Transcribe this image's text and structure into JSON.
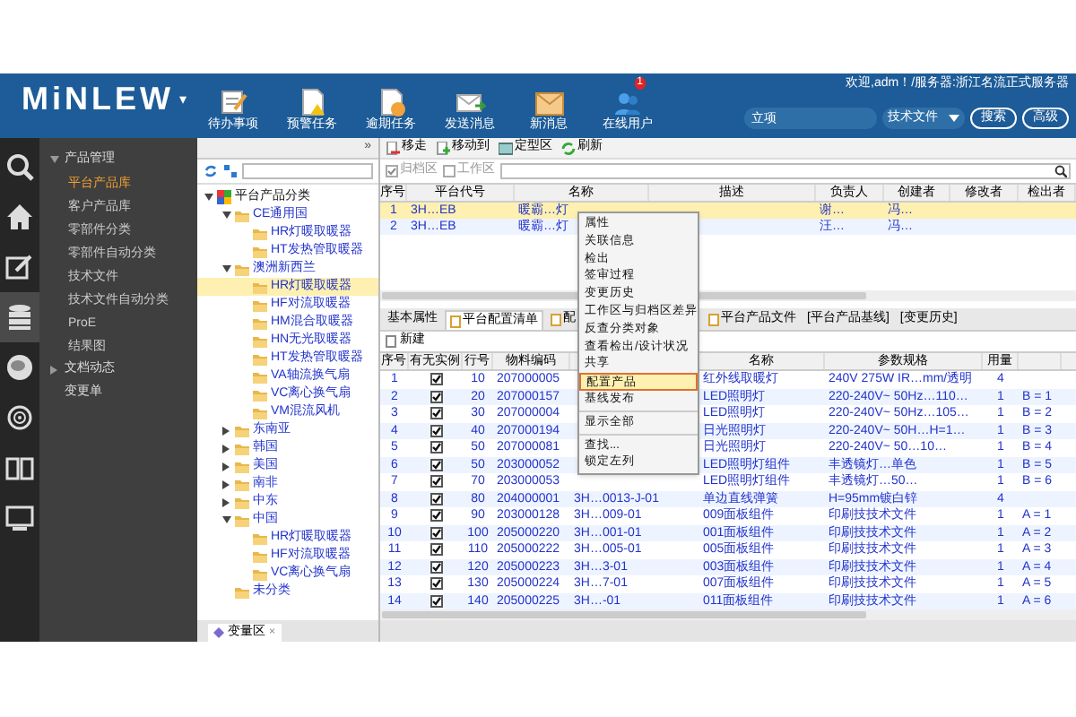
{
  "header": {
    "logo": "MiNLEW",
    "logo_caret": "▾",
    "welcome": "欢迎,adm！/服务器:浙江名流正式服务器",
    "nav_buttons": [
      {
        "label": "待办事项",
        "kind": "todo"
      },
      {
        "label": "预警任务",
        "kind": "warning"
      },
      {
        "label": "逾期任务",
        "kind": "overdue"
      },
      {
        "label": "发送消息",
        "kind": "send"
      },
      {
        "label": "新消息",
        "kind": "inbox"
      },
      {
        "label": "在线用户",
        "kind": "users",
        "badge": "1"
      }
    ],
    "search": {
      "value": "立项"
    },
    "scope": "技术文件",
    "buttons": [
      "搜索",
      "高级"
    ]
  },
  "icon_bar": [
    {
      "kind": "search",
      "selected": false
    },
    {
      "kind": "home",
      "selected": false
    },
    {
      "kind": "edit",
      "selected": false
    },
    {
      "kind": "database",
      "selected": true
    },
    {
      "kind": "chat",
      "selected": false
    },
    {
      "kind": "broadcast",
      "selected": false
    },
    {
      "kind": "book",
      "selected": false
    },
    {
      "kind": "card",
      "selected": false
    }
  ],
  "nav": [
    {
      "label": "产品管理",
      "expanded": true,
      "children": [
        {
          "label": "平台产品库",
          "selected": true
        },
        {
          "label": "客户产品库",
          "selected": false
        },
        {
          "label": "零部件分类",
          "selected": false
        },
        {
          "label": "零部件自动分类",
          "selected": false
        },
        {
          "label": "技术文件",
          "selected": false
        },
        {
          "label": "技术文件自动分类",
          "selected": false
        },
        {
          "label": "ProE",
          "selected": false
        },
        {
          "label": "结果图",
          "selected": false
        }
      ]
    },
    {
      "label": "文档动态",
      "expanded": false
    },
    {
      "label": "变更单"
    }
  ],
  "tree": {
    "collapse_mark": "»",
    "root": {
      "label": "平台产品分类",
      "expanded": true,
      "selected": false,
      "children": [
        {
          "label": "CE通用国",
          "expanded": true,
          "selected": false,
          "children": [
            {
              "label": "HR灯暖取暖器",
              "selected": false
            },
            {
              "label": "HT发热管取暖器",
              "selected": false
            }
          ]
        },
        {
          "label": "澳洲新西兰",
          "expanded": true,
          "selected": false,
          "children": [
            {
              "label": "HR灯暖取暖器",
              "selected": true
            },
            {
              "label": "HF对流取暖器",
              "selected": false
            },
            {
              "label": "HM混合取暖器",
              "selected": false
            },
            {
              "label": "HN无光取暖器",
              "selected": false
            },
            {
              "label": "HT发热管取暖器",
              "selected": false
            },
            {
              "label": "VA轴流换气扇",
              "selected": false
            },
            {
              "label": "VC离心换气扇",
              "selected": false
            },
            {
              "label": "VM混流风机",
              "selected": false
            }
          ]
        },
        {
          "label": "东南亚",
          "expanded": false,
          "selected": false
        },
        {
          "label": "韩国",
          "expanded": false,
          "selected": false
        },
        {
          "label": "美国",
          "expanded": false,
          "selected": false
        },
        {
          "label": "南非",
          "expanded": false,
          "selected": false
        },
        {
          "label": "中东",
          "expanded": false,
          "selected": false
        },
        {
          "label": "中国",
          "expanded": true,
          "selected": false,
          "children": [
            {
              "label": "HR灯暖取暖器",
              "selected": false
            },
            {
              "label": "HF对流取暖器",
              "selected": false
            },
            {
              "label": "VC离心换气扇",
              "selected": false
            }
          ]
        },
        {
          "label": "未分类",
          "selected": false
        }
      ]
    },
    "bottom_tab": "变量区",
    "bottom_tab_close": "×"
  },
  "toolbar": [
    "移走",
    "移动到",
    "定型区",
    "刷新"
  ],
  "filters": [
    {
      "label": "归档区",
      "checked": true
    },
    {
      "label": "工作区",
      "checked": false
    }
  ],
  "top_table": {
    "columns": [
      "序号",
      "平台代号",
      "名称",
      "描述",
      "负责人",
      "创建者",
      "修改者",
      "检出者"
    ],
    "rows": [
      {
        "selected": true,
        "cells": [
          "1",
          "3H…EB",
          "暖霸…灯",
          "",
          "谢…",
          "冯…",
          "",
          ""
        ]
      },
      {
        "selected": false,
        "cells": [
          "2",
          "3H…EB",
          "暖霸…灯",
          "",
          "汪…",
          "冯…",
          "",
          ""
        ]
      }
    ]
  },
  "detail_tabs": [
    {
      "label": "基本属性",
      "selected": false
    },
    {
      "label": "平台配置清单",
      "selected": true
    },
    {
      "label": "配",
      "selected": false
    },
    {
      "label": "平台产品文件",
      "selected": false
    },
    {
      "label": "[平台产品基线]",
      "selected": false
    },
    {
      "label": "[变更历史]",
      "selected": false
    }
  ],
  "detail_toolbar": "新建",
  "bom_table": {
    "columns": [
      "序号",
      "有无实例",
      "行号",
      "物料编码",
      "",
      "名称",
      "参数规格",
      "用量",
      ""
    ],
    "rows": [
      {
        "has_instance": true,
        "cells": [
          "1",
          "",
          "10",
          "207000005",
          "",
          "红外线取暖灯",
          "240V 275W IR…mm/透明",
          "4",
          ""
        ]
      },
      {
        "has_instance": true,
        "cells": [
          "2",
          "",
          "20",
          "207000157",
          "",
          "LED照明灯",
          "220-240V~ 50Hz…110…",
          "1",
          "B = 1"
        ]
      },
      {
        "has_instance": true,
        "cells": [
          "3",
          "",
          "30",
          "207000004",
          "",
          "LED照明灯",
          "220-240V~ 50Hz…105…",
          "1",
          "B = 2"
        ]
      },
      {
        "has_instance": true,
        "cells": [
          "4",
          "",
          "40",
          "207000194",
          "",
          "日光照明灯",
          "220-240V~ 50H…H=1…",
          "1",
          "B = 3"
        ]
      },
      {
        "has_instance": true,
        "cells": [
          "5",
          "",
          "50",
          "207000081",
          "",
          "日光照明灯",
          "220-240V~ 50…10…",
          "1",
          "B = 4"
        ]
      },
      {
        "has_instance": true,
        "cells": [
          "6",
          "",
          "50",
          "203000052",
          "",
          "LED照明灯组件",
          "丰透镜灯…单色",
          "1",
          "B = 5"
        ]
      },
      {
        "has_instance": true,
        "cells": [
          "7",
          "",
          "70",
          "203000053",
          "",
          "LED照明灯组件",
          "丰透镜灯…50…",
          "1",
          "B = 6"
        ]
      },
      {
        "has_instance": true,
        "cells": [
          "8",
          "",
          "80",
          "204000001",
          "3H…0013-J-01",
          "单边直线弹簧",
          "H=95mm镀白锌",
          "4",
          ""
        ]
      },
      {
        "has_instance": true,
        "cells": [
          "9",
          "",
          "90",
          "203000128",
          "3H…009-01",
          "009面板组件",
          "印刷技技术文件",
          "1",
          "A = 1"
        ]
      },
      {
        "has_instance": true,
        "cells": [
          "10",
          "",
          "100",
          "205000220",
          "3H…001-01",
          "001面板组件",
          "印刷技技术文件",
          "1",
          "A = 2"
        ]
      },
      {
        "has_instance": true,
        "cells": [
          "11",
          "",
          "110",
          "205000222",
          "3H…005-01",
          "005面板组件",
          "印刷技技术文件",
          "1",
          "A = 3"
        ]
      },
      {
        "has_instance": true,
        "cells": [
          "12",
          "",
          "120",
          "205000223",
          "3H…3-01",
          "003面板组件",
          "印刷技技术文件",
          "1",
          "A = 4"
        ]
      },
      {
        "has_instance": true,
        "cells": [
          "13",
          "",
          "130",
          "205000224",
          "3H…7-01",
          "007面板组件",
          "印刷技技术文件",
          "1",
          "A = 5"
        ]
      },
      {
        "has_instance": true,
        "cells": [
          "14",
          "",
          "140",
          "205000225",
          "3H…-01",
          "011面板组件",
          "印刷技技术文件",
          "1",
          "A = 6"
        ]
      }
    ]
  },
  "context_menu": [
    {
      "kind": "item",
      "label": "属性",
      "selected": false
    },
    {
      "kind": "item",
      "label": "关联信息",
      "selected": false
    },
    {
      "kind": "item",
      "label": "检出",
      "selected": false
    },
    {
      "kind": "item",
      "label": "签审过程",
      "selected": false
    },
    {
      "kind": "item",
      "label": "变更历史",
      "selected": false
    },
    {
      "kind": "item",
      "label": "工作区与归档区差异",
      "selected": false
    },
    {
      "kind": "item",
      "label": "反查分类对象",
      "selected": false
    },
    {
      "kind": "item",
      "label": "查看检出/设计状况",
      "selected": false
    },
    {
      "kind": "item",
      "label": "共享",
      "selected": false
    },
    {
      "kind": "item",
      "label": "配置产品",
      "selected": true
    },
    {
      "kind": "item",
      "label": "基线发布",
      "selected": false
    },
    {
      "kind": "separator"
    },
    {
      "kind": "item",
      "label": "显示全部",
      "selected": false
    },
    {
      "kind": "separator"
    },
    {
      "kind": "item",
      "label": "查找...",
      "selected": false
    },
    {
      "kind": "item",
      "label": "锁定左列",
      "selected": false
    }
  ]
}
